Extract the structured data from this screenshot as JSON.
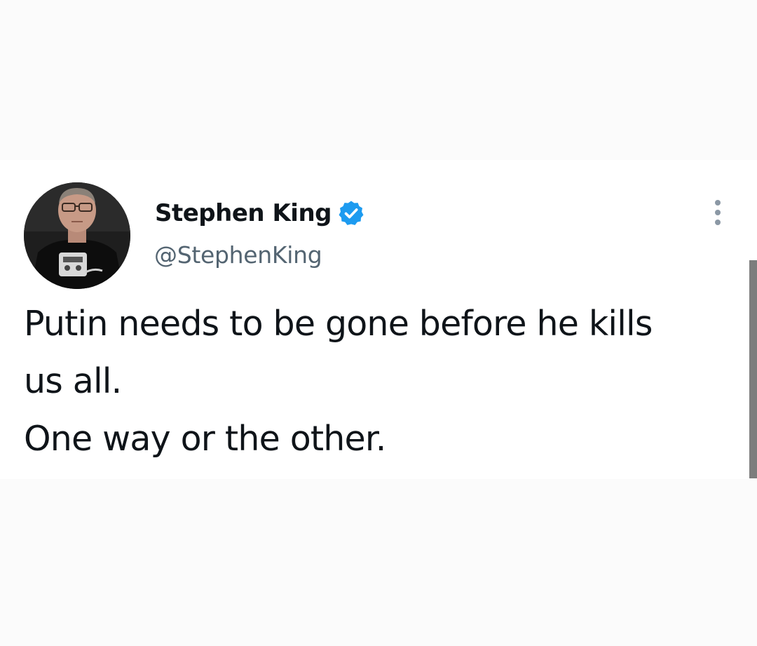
{
  "tweet": {
    "author": {
      "display_name": "Stephen King",
      "handle": "@StephenKing",
      "verified": true,
      "avatar_icon": "profile-photo"
    },
    "text_lines": [
      "Putin needs to be gone before he kills",
      "us all.",
      "One way or the other."
    ],
    "more_icon": "more-options-icon"
  },
  "colors": {
    "background": "#fbfbfb",
    "card": "#ffffff",
    "text_primary": "#0f1419",
    "text_secondary": "#536471",
    "verified_blue": "#1d9bf0",
    "scrollbar": "#7d7d7d"
  }
}
